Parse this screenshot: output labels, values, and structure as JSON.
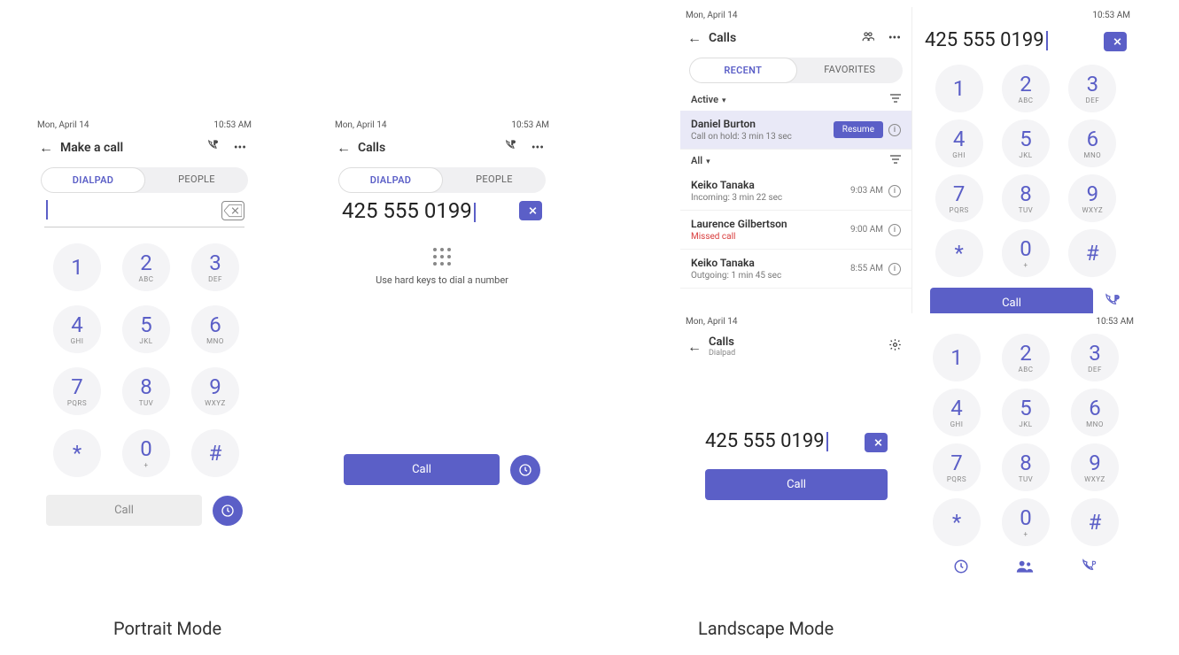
{
  "status": {
    "date": "Mon, April 14",
    "time": "10:53 AM"
  },
  "portrait1": {
    "title": "Make a call",
    "tabs": {
      "dialpad": "DIALPAD",
      "people": "PEOPLE"
    },
    "number": "",
    "call_label": "Call",
    "keys": [
      {
        "d": "1",
        "l": ""
      },
      {
        "d": "2",
        "l": "ABC"
      },
      {
        "d": "3",
        "l": "DEF"
      },
      {
        "d": "4",
        "l": "GHI"
      },
      {
        "d": "5",
        "l": "JKL"
      },
      {
        "d": "6",
        "l": "MNO"
      },
      {
        "d": "7",
        "l": "PQRS"
      },
      {
        "d": "8",
        "l": "TUV"
      },
      {
        "d": "9",
        "l": "WXYZ"
      },
      {
        "d": "*",
        "l": ""
      },
      {
        "d": "0",
        "l": "+"
      },
      {
        "d": "#",
        "l": ""
      }
    ]
  },
  "portrait2": {
    "title": "Calls",
    "tabs": {
      "dialpad": "DIALPAD",
      "people": "PEOPLE"
    },
    "number": "425 555 0199",
    "hint": "Use hard keys to dial a number",
    "call_label": "Call"
  },
  "landscape1": {
    "title": "Calls",
    "tabs": {
      "recent": "RECENT",
      "favorites": "FAVORITES"
    },
    "number": "425 555 0199",
    "call_label": "Call",
    "active_label": "Active",
    "all_label": "All",
    "hold": {
      "name": "Daniel Burton",
      "sub": "Call on hold: 3 min 13 sec",
      "action": "Resume"
    },
    "calls": [
      {
        "name": "Keiko Tanaka",
        "sub": "Incoming: 3 min 22 sec",
        "time": "9:03 AM"
      },
      {
        "name": "Laurence Gilbertson",
        "sub": "Missed call",
        "time": "9:00 AM",
        "missed": true
      },
      {
        "name": "Keiko Tanaka",
        "sub": "Outgoing: 1 min 45 sec",
        "time": "8:55 AM"
      }
    ]
  },
  "landscape2": {
    "title": "Calls",
    "subtitle": "Dialpad",
    "number": "425 555 0199",
    "call_label": "Call"
  },
  "captions": {
    "portrait": "Portrait Mode",
    "landscape": "Landscape Mode"
  },
  "keys": [
    {
      "d": "1",
      "l": ""
    },
    {
      "d": "2",
      "l": "ABC"
    },
    {
      "d": "3",
      "l": "DEF"
    },
    {
      "d": "4",
      "l": "GHI"
    },
    {
      "d": "5",
      "l": "JKL"
    },
    {
      "d": "6",
      "l": "MNO"
    },
    {
      "d": "7",
      "l": "PQRS"
    },
    {
      "d": "8",
      "l": "TUV"
    },
    {
      "d": "9",
      "l": "WXYZ"
    },
    {
      "d": "*",
      "l": ""
    },
    {
      "d": "0",
      "l": "+"
    },
    {
      "d": "#",
      "l": ""
    }
  ]
}
